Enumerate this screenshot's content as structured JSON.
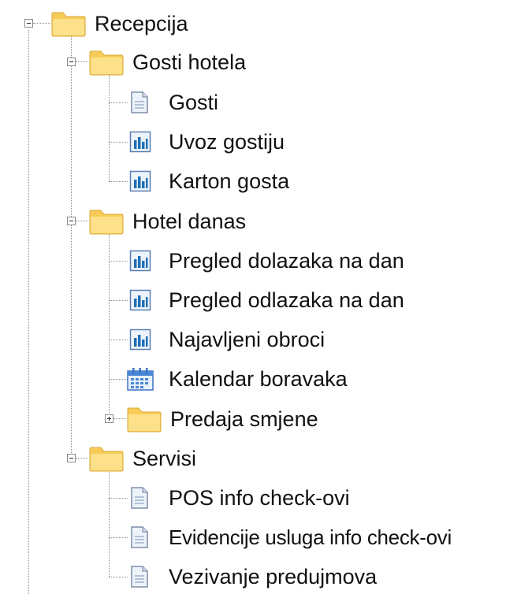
{
  "tree": {
    "recepcija": {
      "label": "Recepcija",
      "icon": "folder-icon",
      "state": "expanded",
      "groups": {
        "gosti_hotela": {
          "label": "Gosti hotela",
          "icon": "folder-icon",
          "state": "expanded",
          "items": [
            {
              "label": "Gosti",
              "icon": "document-icon"
            },
            {
              "label": "Uvoz gostiju",
              "icon": "report-icon"
            },
            {
              "label": "Karton gosta",
              "icon": "report-icon"
            }
          ]
        },
        "hotel_danas": {
          "label": "Hotel danas",
          "icon": "folder-icon",
          "state": "expanded",
          "items": [
            {
              "label": "Pregled dolazaka na dan",
              "icon": "report-icon"
            },
            {
              "label": "Pregled odlazaka na dan",
              "icon": "report-icon"
            },
            {
              "label": "Najavljeni obroci",
              "icon": "report-icon"
            },
            {
              "label": "Kalendar boravaka",
              "icon": "calendar-icon"
            }
          ],
          "subfolder": {
            "label": "Predaja smjene",
            "icon": "folder-icon",
            "state": "collapsed"
          }
        },
        "servisi": {
          "label": "Servisi",
          "icon": "folder-icon",
          "state": "expanded",
          "items": [
            {
              "label": "POS info check-ovi",
              "icon": "document-icon"
            },
            {
              "label": "Evidencije usluga info check-ovi",
              "icon": "document-icon"
            },
            {
              "label": "Vezivanje predujmova",
              "icon": "document-icon"
            }
          ]
        }
      }
    }
  },
  "colors": {
    "folder": "#f7cc56",
    "folder_light": "#fde9a4",
    "report_bars": "#1e6fb5",
    "calendar": "#4a86d6",
    "lines": "#8a8a8a"
  }
}
